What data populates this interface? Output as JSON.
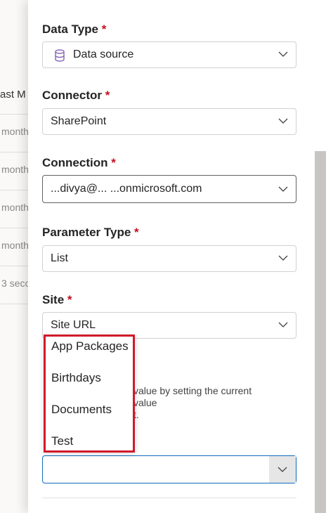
{
  "background": {
    "header": "ast M",
    "rows": [
      "month",
      "month",
      "month",
      "month",
      "3 seco"
    ]
  },
  "form": {
    "data_type": {
      "label": "Data Type",
      "value": "Data source",
      "icon": "database-icon"
    },
    "connector": {
      "label": "Connector",
      "value": "SharePoint"
    },
    "connection": {
      "label": "Connection",
      "value": "...divya@... ...onmicrosoft.com"
    },
    "parameter_type": {
      "label": "Parameter Type",
      "value": "List"
    },
    "site": {
      "label": "Site",
      "value": "Site URL"
    },
    "description": "value by setting the current value",
    "description_line2": "t.",
    "required_mark": "*",
    "list_value": ""
  },
  "dropdown": {
    "options": [
      "App Packages",
      "Birthdays",
      "Documents",
      "Test"
    ],
    "highlight_color": "#d11a2a"
  },
  "colors": {
    "required": "#c50f1f",
    "focus": "#0f6cbd",
    "icon_purple": "#8764b8"
  }
}
